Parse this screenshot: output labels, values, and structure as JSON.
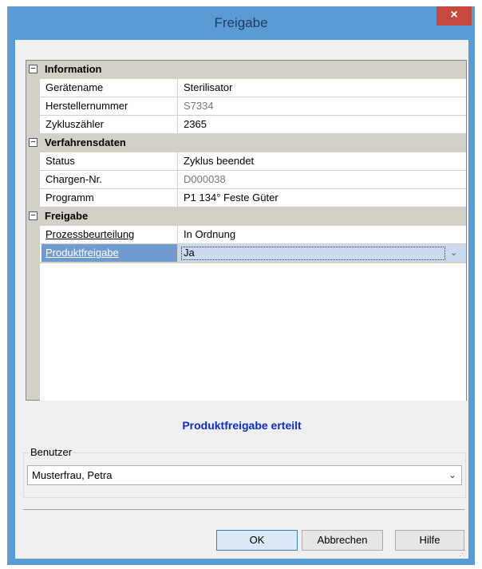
{
  "window": {
    "title": "Freigabe",
    "close_glyph": "×"
  },
  "grid": {
    "categories": [
      {
        "label": "Information",
        "toggle": "−"
      },
      {
        "label": "Verfahrensdaten",
        "toggle": "−"
      },
      {
        "label": "Freigabe",
        "toggle": "−"
      }
    ],
    "rows": [
      {
        "name": "Gerätename",
        "value": "Sterilisator"
      },
      {
        "name": "Herstellernummer",
        "value": "S7334"
      },
      {
        "name": "Zykluszähler",
        "value": "2365"
      },
      {
        "name": "Status",
        "value": "Zyklus beendet"
      },
      {
        "name": "Chargen-Nr.",
        "value": "D000038"
      },
      {
        "name": "Programm",
        "value": "P1 134° Feste Güter"
      },
      {
        "name": "Prozessbeurteilung",
        "value": "In Ordnung"
      },
      {
        "name": "Produktfreigabe",
        "value": "Ja"
      }
    ],
    "dropdown_glyph": "⌄"
  },
  "status_message": "Produktfreigabe erteilt",
  "user_group": {
    "legend": "Benutzer",
    "selected": "Musterfrau, Petra",
    "arrow": "⌄"
  },
  "buttons": {
    "ok": "OK",
    "cancel": "Abbrechen",
    "help": "Hilfe"
  },
  "colors": {
    "accent": "#5b9bd5",
    "close": "#c7493d",
    "status": "#0b2bd6",
    "selection": "#6f9bd1"
  }
}
